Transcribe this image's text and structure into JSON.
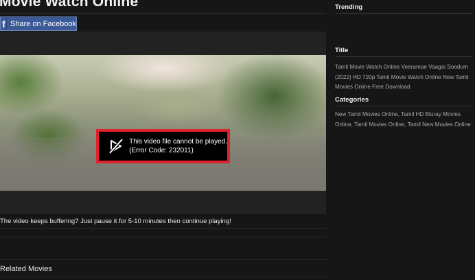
{
  "page": {
    "title": "Movie Watch Online",
    "share_button": "Share on Facebook",
    "share_icon": "f"
  },
  "player": {
    "error_icon": "video-blocked-icon",
    "error_line1": "This video file cannot be played.",
    "error_line2": "(Error Code: 232011)",
    "error_border_color": "#e0202a"
  },
  "notes": {
    "buffer": "The video keeps buffering? Just pause it for 5-10 minutes then continue playing!"
  },
  "related": {
    "title": "Related Movies"
  },
  "sidebar": {
    "trending_heading": "Trending",
    "title_heading": "Title",
    "title_text": "Tamil Movie Watch Online Veeramae Vaagai Soodum (2022) HD 720p Tamil Movie Watch Online New Tamil Movies Online Free Download",
    "categories_heading": "Categories",
    "categories_text": "New Tamil Movies Online, Tamil HD Bluray Movies Online, Tamil Movies Online, Tamil New Movies Online"
  }
}
